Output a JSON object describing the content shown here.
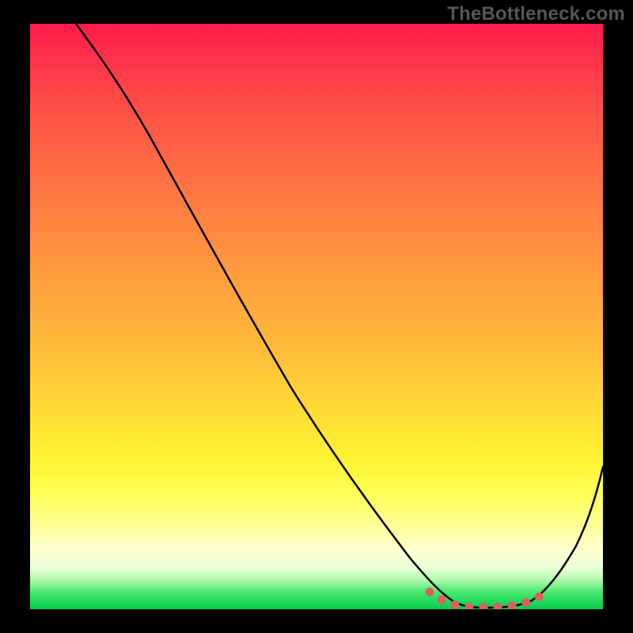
{
  "watermark": "TheBottleneck.com",
  "chart_data": {
    "type": "line",
    "title": "",
    "xlabel": "",
    "ylabel": "",
    "xlim": [
      0,
      100
    ],
    "ylim": [
      0,
      100
    ],
    "series": [
      {
        "name": "curve",
        "x": [
          8,
          12,
          18,
          25,
          32,
          40,
          48,
          56,
          62,
          66,
          70,
          73,
          76,
          79,
          82,
          85,
          88,
          92,
          96,
          100
        ],
        "y": [
          100,
          97,
          91,
          81,
          70,
          58,
          46,
          33,
          22,
          14,
          8,
          4,
          1.5,
          0.5,
          0.2,
          0.2,
          1,
          4,
          12,
          26
        ]
      }
    ],
    "optimal_range": {
      "x_start": 70,
      "x_end": 89,
      "note": "dotted salmon segment at valley"
    },
    "background": "vertical rainbow gradient red→yellow→green",
    "grid": false,
    "legend": false
  }
}
